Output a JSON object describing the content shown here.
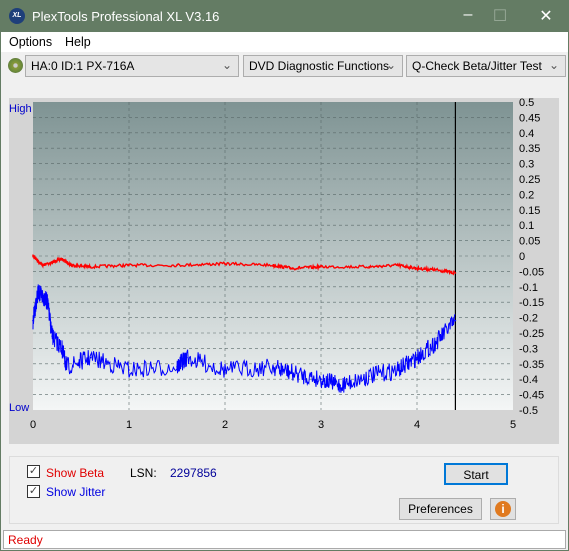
{
  "window": {
    "title": "PlexTools Professional XL V3.16",
    "logo_text": "XL"
  },
  "menu": {
    "items": [
      "Options",
      "Help"
    ]
  },
  "toolbar": {
    "drive": "HA:0 ID:1  PX-716A",
    "function": "DVD Diagnostic Functions",
    "test": "Q-Check Beta/Jitter Test"
  },
  "chart_labels": {
    "high": "High",
    "low": "Low"
  },
  "chart_data": {
    "type": "line",
    "xlim": [
      0,
      5
    ],
    "ylim": [
      -0.5,
      0.5
    ],
    "x_ticks": [
      "0",
      "1",
      "2",
      "3",
      "4",
      "5"
    ],
    "y_ticks": [
      "0.5",
      "0.45",
      "0.4",
      "0.35",
      "0.3",
      "0.25",
      "0.2",
      "0.15",
      "0.1",
      "0.05",
      "0",
      "-0.05",
      "-0.1",
      "-0.15",
      "-0.2",
      "-0.25",
      "-0.3",
      "-0.35",
      "-0.4",
      "-0.45",
      "-0.5"
    ],
    "grid": true,
    "marker_x": 4.4,
    "series": [
      {
        "name": "Beta",
        "color": "#ff0000",
        "x": [
          0,
          0.1,
          0.2,
          0.3,
          0.4,
          0.6,
          1.0,
          1.5,
          2.0,
          2.5,
          2.7,
          3.0,
          3.5,
          3.8,
          4.0,
          4.2,
          4.4
        ],
        "y": [
          0,
          -0.03,
          -0.02,
          -0.01,
          -0.03,
          -0.035,
          -0.03,
          -0.03,
          -0.025,
          -0.03,
          -0.04,
          -0.035,
          -0.035,
          -0.03,
          -0.04,
          -0.045,
          -0.055
        ]
      },
      {
        "name": "Jitter",
        "color": "#0000ff",
        "x": [
          0,
          0.05,
          0.1,
          0.15,
          0.2,
          0.3,
          0.35,
          0.6,
          1.0,
          1.5,
          1.6,
          2.0,
          2.5,
          2.7,
          3.0,
          3.2,
          3.5,
          3.8,
          4.0,
          4.2,
          4.4
        ],
        "y": [
          -0.21,
          -0.12,
          -0.13,
          -0.15,
          -0.26,
          -0.3,
          -0.36,
          -0.33,
          -0.37,
          -0.36,
          -0.33,
          -0.37,
          -0.36,
          -0.38,
          -0.4,
          -0.42,
          -0.39,
          -0.37,
          -0.33,
          -0.28,
          -0.21
        ]
      }
    ]
  },
  "controls": {
    "show_beta": "Show Beta",
    "show_jitter": "Show Jitter",
    "lsn_label": "LSN:",
    "lsn_value": "2297856",
    "start": "Start",
    "preferences": "Preferences"
  },
  "status": "Ready"
}
